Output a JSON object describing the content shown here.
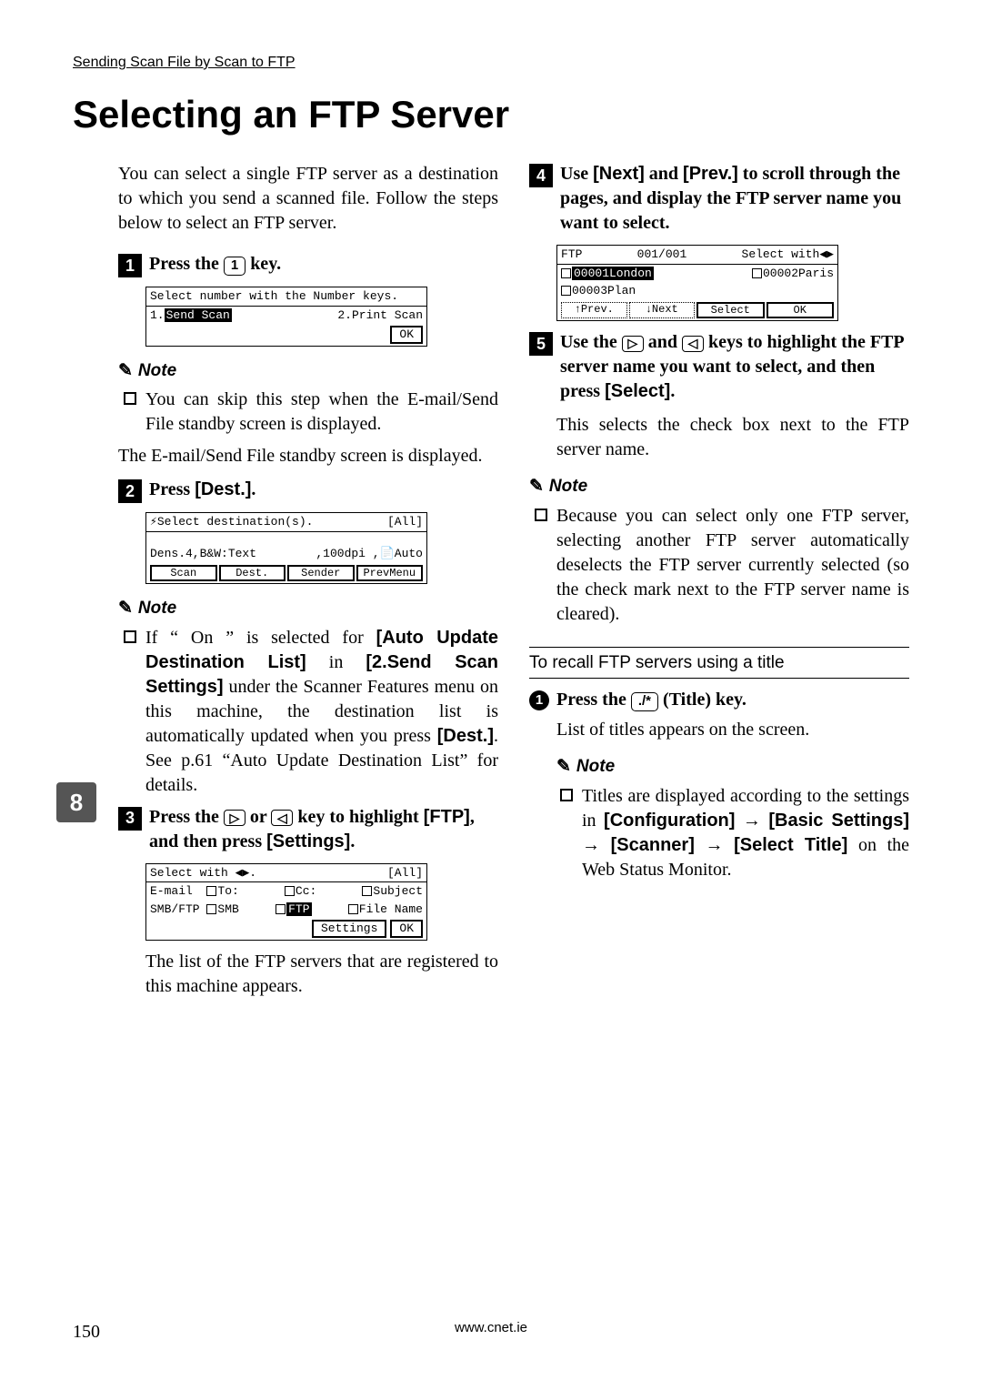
{
  "header": "Sending Scan File by Scan to FTP",
  "title": "Selecting an FTP Server",
  "side_tab": "8",
  "intro": "You can select a single FTP server as a destination to which you send a scanned file. Follow the steps below to select an FTP server.",
  "step1_prefix": "Press the ",
  "step1_key": "1",
  "step1_suffix": " key.",
  "screen1": {
    "line1": "Select number with the Number keys.",
    "opt1_prefix": "1.",
    "opt1_label": "Send Scan",
    "opt2": "2.Print Scan",
    "ok": "OK"
  },
  "note_label": "Note",
  "note1_bullet": "You can skip this step when the E-mail/Send File standby screen is displayed.",
  "note1_para": "The E-mail/Send File standby screen is displayed.",
  "step2_prefix": "Press ",
  "step2_label": "[Dest.]",
  "step2_suffix": ".",
  "screen2": {
    "line1_a": "Select destination(s).",
    "line1_b": "[All]",
    "line2": "",
    "line3_a": "Dens.4,B&W:Text",
    "line3_b": ",100dpi ,",
    "line3_c": "Auto",
    "btns": [
      "Scan",
      "Dest.",
      "Sender",
      "PrevMenu"
    ]
  },
  "note2_b1": "If “ On ” is selected for ",
  "note2_b1_s1": "[Auto Update Destination List]",
  "note2_b1_mid": " in ",
  "note2_b1_s2": "[2.Send Scan Settings]",
  "note2_b1_tail": " under the Scanner Features menu on this machine, the destination list is automatically updated when you press ",
  "note2_b1_s3": "[Dest.]",
  "note2_b1_end": ". See p.61 “Auto Update Destination List” for details.",
  "step3_prefix": "Press the ",
  "step3_mid": " or ",
  "step3_tail1": " key to highlight ",
  "step3_ftp": "[FTP]",
  "step3_tail2": ", and then press ",
  "step3_set": "[Settings]",
  "step3_end": ".",
  "screen3": {
    "line1_a": "Select with",
    "line1_b": "[All]",
    "r1": [
      "E-mail",
      "To:",
      "Cc:",
      "Subject"
    ],
    "r2": [
      "SMB/FTP",
      "SMB",
      "FTP",
      "File Name"
    ],
    "btns": [
      "Settings",
      "OK"
    ]
  },
  "after3": "The list of the FTP servers that are registered to this machine appears.",
  "step4_prefix": "Use ",
  "step4_next": "[Next]",
  "step4_and": " and ",
  "step4_prev": "[Prev.]",
  "step4_tail": " to scroll through the pages, and display the FTP server name you want to select.",
  "screen4": {
    "hdr_a": "FTP",
    "hdr_b": "001/001",
    "hdr_c": "Select with",
    "r1a": "00001London",
    "r1b": "00002Paris",
    "r2a": "00003Plan",
    "btns_dash": [
      "↑Prev.",
      "↓Next"
    ],
    "btns_solid": [
      "Select",
      "OK"
    ]
  },
  "step5_prefix": "Use the ",
  "step5_and": " and ",
  "step5_tail1": " keys to highlight the FTP server name you want to select, and then press ",
  "step5_sel": "[Select]",
  "step5_end": ".",
  "after5": "This selects the check box next to the FTP server name.",
  "note5_bullet": "Because you can select only one FTP server, selecting another FTP server automatically deselects the FTP server currently selected (so the check mark next to the FTP server name is cleared).",
  "subhead": "To recall FTP servers using a title",
  "sub1_prefix": "Press the ",
  "sub1_key": "./*",
  "sub1_suffix": " (Title) key.",
  "sub1_para": "List of titles appears on the screen.",
  "sub_note_b": "Titles are displayed according to the settings in ",
  "sub_note_s1": "[Configuration]",
  "sub_note_arrow": " → ",
  "sub_note_s2": "[Basic Settings]",
  "sub_note_s3": "[Scanner]",
  "sub_note_s4": "[Select Title]",
  "sub_note_tail": " on the Web Status Monitor.",
  "page_num": "150",
  "footer_url": "www.cnet.ie"
}
